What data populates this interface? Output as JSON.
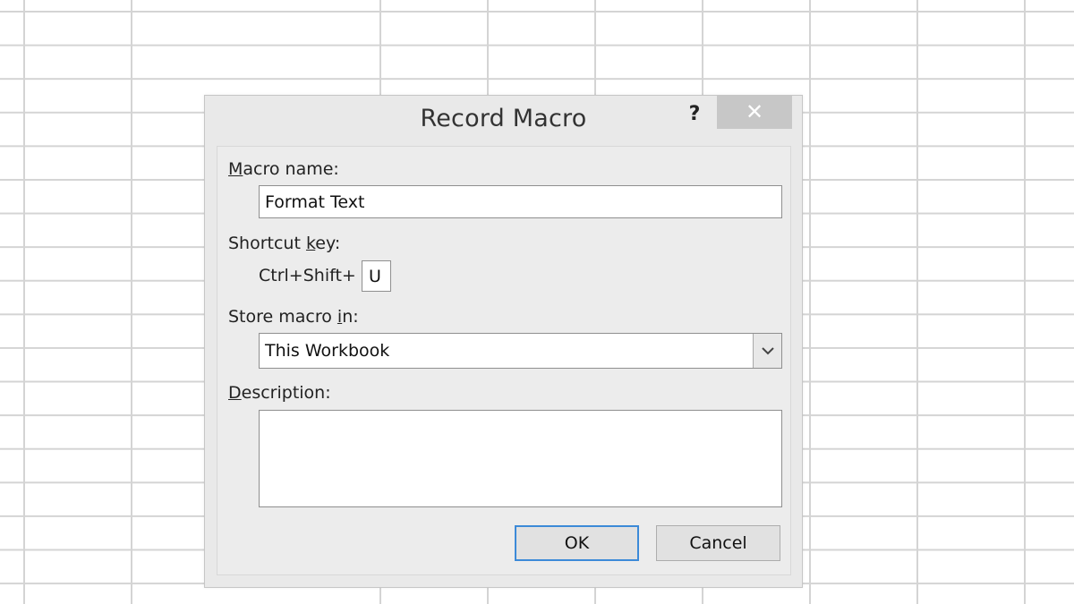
{
  "dialog": {
    "title": "Record Macro",
    "help_label": "?",
    "close_label": "✕",
    "macro_name": {
      "label_access_key": "M",
      "label_rest": "acro name:",
      "value": "Format Text"
    },
    "shortcut": {
      "label_before": "Shortcut ",
      "label_access_key": "k",
      "label_after": "ey:",
      "prefix": "Ctrl+Shift+",
      "value": "U"
    },
    "store": {
      "label_before": "Store macro ",
      "label_access_key": "i",
      "label_after": "n:",
      "selected": "This Workbook"
    },
    "description": {
      "label_access_key": "D",
      "label_rest": "escription:",
      "value": ""
    },
    "ok_label": "OK",
    "cancel_label": "Cancel"
  },
  "colors": {
    "grid_line": "#d4d4d4",
    "dialog_bg": "#e9e9e9",
    "close_bg": "#c7c7c7",
    "default_button_border": "#3c8ad8"
  }
}
